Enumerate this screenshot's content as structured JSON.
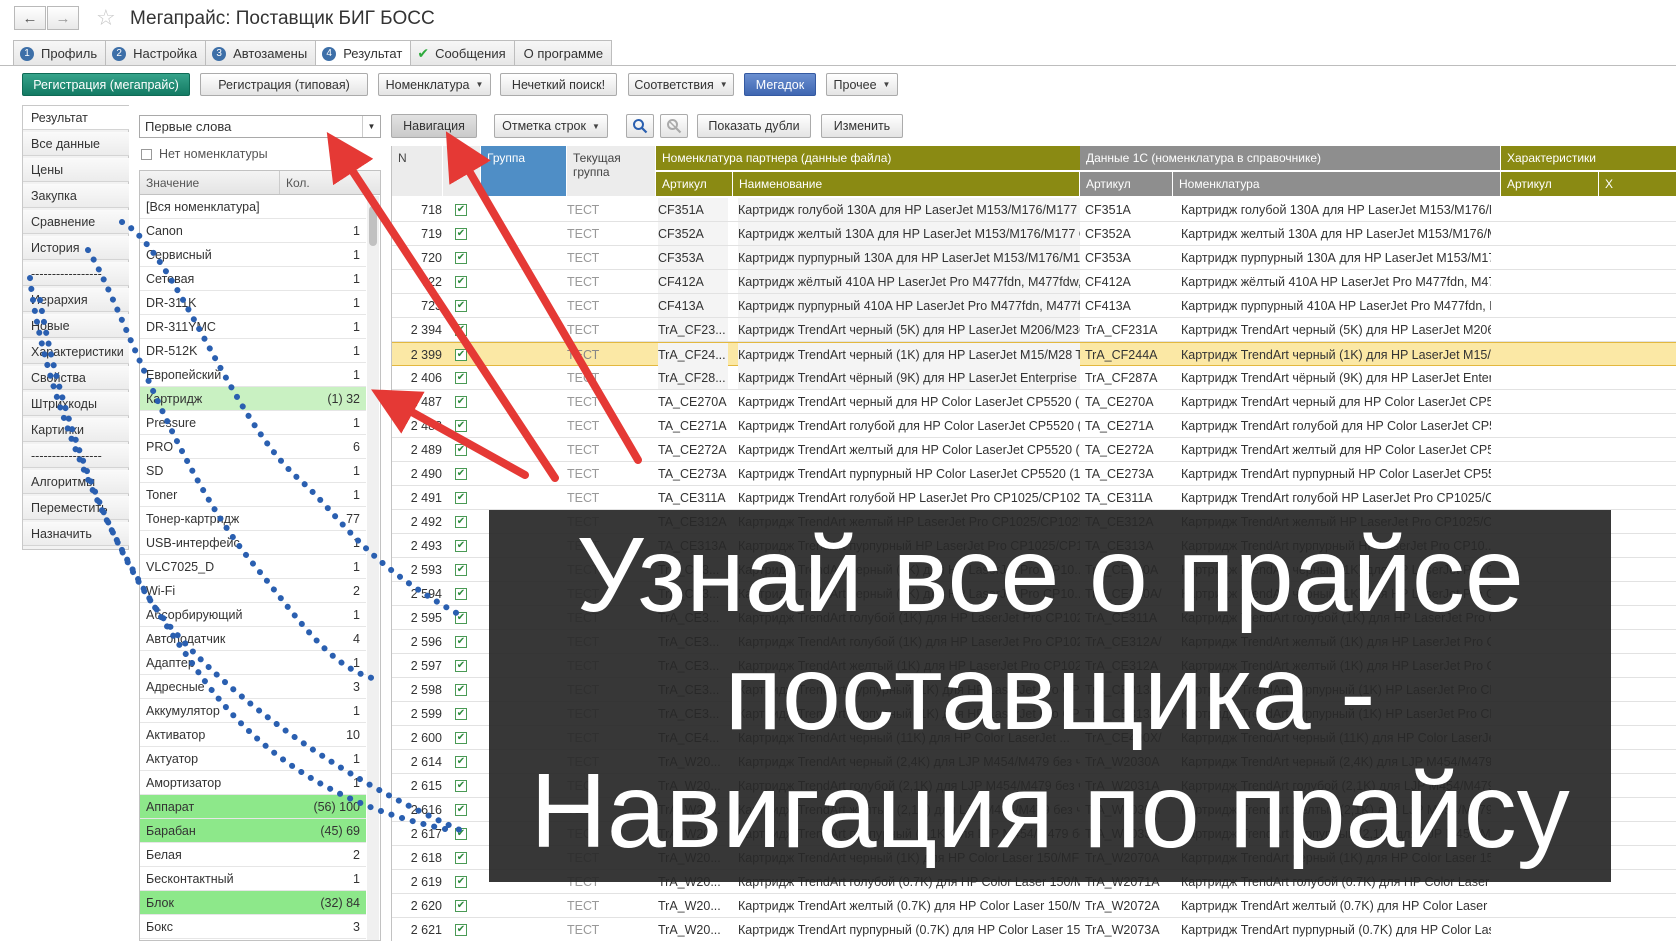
{
  "window": {
    "title": "Мегапрайс: Поставщик БИГ БОСС",
    "back_icon": "arrow-left-icon",
    "forward_icon": "arrow-right-icon",
    "favorite_icon": "star-icon"
  },
  "tabs": [
    {
      "num": "1",
      "label": "Профиль"
    },
    {
      "num": "2",
      "label": "Настройка"
    },
    {
      "num": "3",
      "label": "Автозамены"
    },
    {
      "num": "4",
      "label": "Результат"
    },
    {
      "num": "✔",
      "label": "Сообщения"
    },
    {
      "num": "",
      "label": "О программе"
    }
  ],
  "toolbar": {
    "reg_mega": "Регистрация (мегапрайс)",
    "reg_typical": "Регистрация (типовая)",
    "nomenclature": "Номенклатура",
    "fuzzy_search": "Нечеткий поиск!",
    "correspondence": "Соответствия",
    "megadok": "Мегадок",
    "other": "Прочее"
  },
  "left_panel": {
    "items": [
      "Результат",
      "Все данные",
      "Цены",
      "Закупка",
      "Сравнение",
      "История",
      "-----------------",
      "Иерархия",
      "Новые",
      "Характеристики",
      "Свойства",
      "Штрихкоды",
      "Картинки",
      "-----------------",
      "Алгоритмы",
      "Переместить",
      "Назначить"
    ]
  },
  "filter": {
    "mode": "Первые слова",
    "no_nomenclature": "Нет номенклатуры",
    "col_value": "Значение",
    "col_count": "Кол.",
    "values": [
      {
        "value": "[Вся номенклатура]",
        "count": "",
        "hl": ""
      },
      {
        "value": "Canon",
        "count": "1",
        "hl": ""
      },
      {
        "value": "Сервисный",
        "count": "1",
        "hl": ""
      },
      {
        "value": "Сетевая",
        "count": "1",
        "hl": ""
      },
      {
        "value": "DR-311K",
        "count": "1",
        "hl": ""
      },
      {
        "value": "DR-311YMC",
        "count": "1",
        "hl": ""
      },
      {
        "value": "DR-512K",
        "count": "1",
        "hl": ""
      },
      {
        "value": "Европейский",
        "count": "1",
        "hl": ""
      },
      {
        "value": "Картридж",
        "count": "(1) 32",
        "hl": "light"
      },
      {
        "value": "Pressure",
        "count": "1",
        "hl": ""
      },
      {
        "value": "PRO",
        "count": "6",
        "hl": ""
      },
      {
        "value": "SD",
        "count": "1",
        "hl": ""
      },
      {
        "value": "Toner",
        "count": "1",
        "hl": ""
      },
      {
        "value": "Тонер-картридж",
        "count": "77",
        "hl": ""
      },
      {
        "value": "USB-интерфейс",
        "count": "1",
        "hl": ""
      },
      {
        "value": "VLC7025_D",
        "count": "1",
        "hl": ""
      },
      {
        "value": "Wi-Fi",
        "count": "2",
        "hl": ""
      },
      {
        "value": "Абсорбирующий",
        "count": "1",
        "hl": ""
      },
      {
        "value": "Автоподатчик",
        "count": "4",
        "hl": ""
      },
      {
        "value": "Адаптер",
        "count": "1",
        "hl": ""
      },
      {
        "value": "Адресные",
        "count": "3",
        "hl": ""
      },
      {
        "value": "Аккумулятор",
        "count": "1",
        "hl": ""
      },
      {
        "value": "Активатор",
        "count": "10",
        "hl": ""
      },
      {
        "value": "Актуатор",
        "count": "1",
        "hl": ""
      },
      {
        "value": "Амортизатор",
        "count": "1",
        "hl": ""
      },
      {
        "value": "Аппарат",
        "count": "(56) 100",
        "hl": "strong"
      },
      {
        "value": "Барабан",
        "count": "(45) 69",
        "hl": "strong"
      },
      {
        "value": "Белая",
        "count": "2",
        "hl": ""
      },
      {
        "value": "Бесконтактный",
        "count": "1",
        "hl": ""
      },
      {
        "value": "Блок",
        "count": "(32) 84",
        "hl": "strong"
      },
      {
        "value": "Бокс",
        "count": "3",
        "hl": ""
      }
    ]
  },
  "grid_toolbar": {
    "navigation": "Навигация",
    "row_mark": "Отметка строк",
    "search_icon": "search-icon",
    "search_clear_icon": "search-clear-icon",
    "show_duplicates": "Показать дубли",
    "change": "Изменить"
  },
  "grid": {
    "h_n": "N",
    "h_group": "Группа",
    "h_cur_group": "Текущая группа",
    "h_partner": "Номенклатура партнера (данные файла)",
    "h_article": "Артикул",
    "h_name": "Наименование",
    "h_data1c": "Данные 1С  (номенклатура в справочнике)",
    "h_article2": "Артикул",
    "h_name2": "Номенклатура",
    "h_chars": "Характеристики",
    "h_article3": "Артикул",
    "h_x": "Х",
    "rows": [
      {
        "n": "718",
        "tg": "ТЕСТ",
        "art": "CF351A",
        "name": "Картридж голубой 130А для HP LaserJet M153/M176/M177  C...",
        "art2": "CF351A",
        "name2": "Картридж голубой 130А для HP LaserJet M153/M176/M1..."
      },
      {
        "n": "719",
        "tg": "ТЕСТ",
        "art": "CF352A",
        "name": "Картридж желтый 130А для HP LaserJet M153/M176/M177  C...",
        "art2": "CF352A",
        "name2": "Картридж желтый 130А для HP LaserJet M153/M176/M1..."
      },
      {
        "n": "720",
        "tg": "ТЕСТ",
        "art": "CF353A",
        "name": "Картридж пурпурный 130А для HP LaserJet M153/M176/M177...",
        "art2": "CF353A",
        "name2": "Картридж пурпурный 130А для HP LaserJet M153/M176/..."
      },
      {
        "n": "722",
        "tg": "ТЕСТ",
        "art": "CF412A",
        "name": "Картридж жёлтый 410A HP LaserJet Pro M477fdn, M477fdw, ...",
        "art2": "CF412A",
        "name2": "Картридж жёлтый 410A HP LaserJet Pro M477fdn, M477f..."
      },
      {
        "n": "723",
        "tg": "ТЕСТ",
        "art": "CF413A",
        "name": "Картридж пурпурный 410A HP LaserJet Pro M477fdn, M477f...",
        "art2": "CF413A",
        "name2": "Картридж пурпурный 410A HP LaserJet Pro M477fdn, M4..."
      },
      {
        "n": "2 394",
        "tg": "ТЕСТ",
        "art": "TrA_CF23...",
        "name": "Картридж TrendArt черный (5K) для HP LaserJet M206/M230  ...",
        "art2": "TrA_CF231A",
        "name2": "Картридж TrendArt черный (5K) для HP LaserJet M206/M..."
      },
      {
        "n": "2 399",
        "tg": "ТЕСТ",
        "art": "TrA_CF24...",
        "name": "Картридж TrendArt черный (1K) для HP LaserJet M15/M28  Tr...",
        "art2": "TrA_CF244A",
        "name2": "Картридж TrendArt черный (1K) для HP LaserJet M15/M2...",
        "sel": true
      },
      {
        "n": "2 406",
        "tg": "ТЕСТ",
        "art": "TrA_CF28...",
        "name": "Картридж TrendArt чёрный (9K) для HP LaserJet Enterprise M...",
        "art2": "TrA_CF287A",
        "name2": "Картридж TrendArt чёрный (9K) для HP LaserJet Enterpri..."
      },
      {
        "n": "2 487",
        "tg": "ТЕСТ",
        "art": "TA_CE270A",
        "name": "Картридж TrendArt черный для HP Color LaserJet CP5520 (1...",
        "art2": "TA_CE270A",
        "name2": "Картридж TrendArt черный для HP Color LaserJet CP55..."
      },
      {
        "n": "2 488",
        "tg": "ТЕСТ",
        "art": "TA_CE271A",
        "name": "Картридж TrendArt голубой для HP Color LaserJet CP5520 (1...",
        "art2": "TA_CE271A",
        "name2": "Картридж TrendArt голубой для HP Color LaserJet CP55..."
      },
      {
        "n": "2 489",
        "tg": "ТЕСТ",
        "art": "TA_CE272A",
        "name": "Картридж TrendArt желтый для HP Color LaserJet CP5520 (1...",
        "art2": "TA_CE272A",
        "name2": "Картридж TrendArt желтый для HP Color LaserJet CP55..."
      },
      {
        "n": "2 490",
        "tg": "ТЕСТ",
        "art": "TA_CE273A",
        "name": "Картридж TrendArt пурпурный HP Color LaserJet CP5520 (15...",
        "art2": "TA_CE273A",
        "name2": "Картридж TrendArt пурпурный HP Color LaserJet CP552..."
      },
      {
        "n": "2 491",
        "tg": "ТЕСТ",
        "art": "TA_CE311A",
        "name": "Картридж TrendArt голубой HP LaserJet Pro CP1025/CP1025...",
        "art2": "TA_CE311A",
        "name2": "Картридж TrendArt голубой HP LaserJet Pro CP1025/CP..."
      },
      {
        "n": "2 492",
        "tg": "ТЕСТ",
        "art": "TA_CE312A",
        "name": "Картридж TrendArt желтый HP LaserJet Pro CP1025/CP1025...",
        "art2": "TA_CE312A",
        "name2": "Картридж TrendArt желтый HP LaserJet Pro CP1025/CP..."
      },
      {
        "n": "2 493",
        "tg": "ТЕСТ",
        "art": "TA_CE313A",
        "name": "Картридж TrendArt пурпурный HP LaserJet Pro CP1025/CP10...",
        "art2": "TA_CE313A",
        "name2": "Картридж TrendArt пурпурный HP LaserJet Pro CP10..."
      },
      {
        "n": "2 593",
        "tg": "ТЕСТ",
        "art": "TrA_CE3...",
        "name": "Картридж TrendArt черный (1K) для HP LaserJet Pro CP10...",
        "art2": "TrA_CE310A",
        "name2": "Картридж TrendArt черный (1K) для HP LaserJet Pro C..."
      },
      {
        "n": "2 594",
        "tg": "ТЕСТ",
        "art": "TrA_CE3...",
        "name": "Картридж TrendArt черный (1K) для HP LaserJet Pro CP10...",
        "art2": "TrA_CE310A/",
        "name2": "Картридж TrendArt черный (1K) для HP LaserJet Pro CP1025..."
      },
      {
        "n": "2 595",
        "tg": "ТЕСТ",
        "art": "TrA_CE3...",
        "name": "Картридж TrendArt голубой (1K) для HP LaserJet Pro CP1025...",
        "art2": "TrA_CE311A",
        "name2": "Картридж TrendArt голубой (1K) для HP LaserJet Pro CP1025..."
      },
      {
        "n": "2 596",
        "tg": "ТЕСТ",
        "art": "TrA_CE3...",
        "name": "Картридж TrendArt голубой (1K) для HP LaserJet Pro CP1025/CP1...",
        "art2": "TrA_CE312A/",
        "name2": "Картридж TrendArt желтый (1K) для HP LaserJet Pro CP1025..."
      },
      {
        "n": "2 597",
        "tg": "ТЕСТ",
        "art": "TrA_CE3...",
        "name": "Картридж TrendArt желтый (1K) для HP LaserJet Pro CP1025/CP1...",
        "art2": "TrA_CE312A",
        "name2": "Картридж TrendArt желтый (1K) для HP LaserJet Pro CP1025..."
      },
      {
        "n": "2 598",
        "tg": "ТЕСТ",
        "art": "TrA_CE3...",
        "name": "Картридж TrendArt пурпурный (1K) для HP LaserJet Pro CP1025/CP1...",
        "art2": "TrA_CE313A/",
        "name2": "Картридж TrendArt пурпурный (1K) HP LaserJet Pro CP1..."
      },
      {
        "n": "2 599",
        "tg": "ТЕСТ",
        "art": "TrA_CE3...",
        "name": "Картридж TrendArt пурпурный (1K) для HP LaserJet Pro CP1025/CP1...",
        "art2": "TrA_CE313A",
        "name2": "Картридж TrendArt пурпурный (1K) HP LaserJet Pro CP1..."
      },
      {
        "n": "2 600",
        "tg": "ТЕСТ",
        "art": "TrA_CE4...",
        "name": "Картридж TrendArt черный (11K) для HP Color LaserJet ...",
        "art2": "TrA_CE400X/",
        "name2": "Картридж TrendArt черный (11K) для HP Color LaserJet ..."
      },
      {
        "n": "2 614",
        "tg": "ТЕСТ",
        "art": "TrA_W20...",
        "name": "Картридж TrendArt черный (2,4K) для LJP M454/M479 без чип...",
        "art2": "TrA_W2030A",
        "name2": "Картридж TrendArt черный (2,4K) для LJP M454/M479 бе..."
      },
      {
        "n": "2 615",
        "tg": "ТЕСТ",
        "art": "TrA_W20...",
        "name": "Картридж TrendArt голубой (2,1K) для LJP M454/M479 без чип...",
        "art2": "TrA_W2031A",
        "name2": "Картридж TrendArt голубой (2,1K) для LJP M454/M479 бе..."
      },
      {
        "n": "2 616",
        "tg": "ТЕСТ",
        "art": "TrA_W20...",
        "name": "Картридж TrendArt желтый (2,1K) для LJP M454/M479 без чипа...",
        "art2": "TrA_W2032A",
        "name2": "Картридж TrendArt желтый (2,1K) для LJP M454/M479 бе..."
      },
      {
        "n": "2 617",
        "tg": "ТЕСТ",
        "art": "TrA_W20...",
        "name": "Картридж TrendArt пурпурный (2,1K) для LJP M454/M479 без чипа...",
        "art2": "TrA_W2033A",
        "name2": "Картридж TrendArt пурпурный (2,1K) для LJP M454/M479..."
      },
      {
        "n": "2 618",
        "tg": "ТЕСТ",
        "art": "TrA_W20...",
        "name": "Картридж TrendArt черный (1K) для HP Color Laser 150/MFP...",
        "art2": "TrA_W2070A",
        "name2": "Картридж TrendArt черный (1K) для HP Color Laser 150..."
      },
      {
        "n": "2 619",
        "tg": "ТЕСТ",
        "art": "TrA_W20...",
        "name": "Картридж TrendArt голубой (0.7K) для HP Color Laser 150/MF...",
        "art2": "TrA_W2071A",
        "name2": "Картридж TrendArt голубой (0.7K) для HP Color Laser 15..."
      },
      {
        "n": "2 620",
        "tg": "ТЕСТ",
        "art": "TrA_W20...",
        "name": "Картридж TrendArt желтый (0.7K) для HP Color Laser 150/MFP...",
        "art2": "TrA_W2072A",
        "name2": "Картридж TrendArt желтый (0.7K) для HP Color Laser 15..."
      },
      {
        "n": "2 621",
        "tg": "ТЕСТ",
        "art": "TrA_W20...",
        "name": "Картридж TrendArt пурпурный (0.7K) для HP Color Laser 150/...",
        "art2": "TrA_W2073A",
        "name2": "Картридж TrendArt пурпурный (0.7K) для HP Color Laser 150/..."
      }
    ]
  },
  "banner": {
    "line1": "Узнай все о прайсе",
    "line2": "поставщика -",
    "line3": "Навигация по прайсу"
  },
  "colors": {
    "accent_green": "#137a63",
    "accent_blue": "#3f66b1",
    "header_olive": "#8a8a13",
    "header_blue": "#4f8ec6",
    "arrow_red": "#e53935",
    "dots_blue": "#2a5fb0",
    "selected_row": "#fbe8a5"
  }
}
